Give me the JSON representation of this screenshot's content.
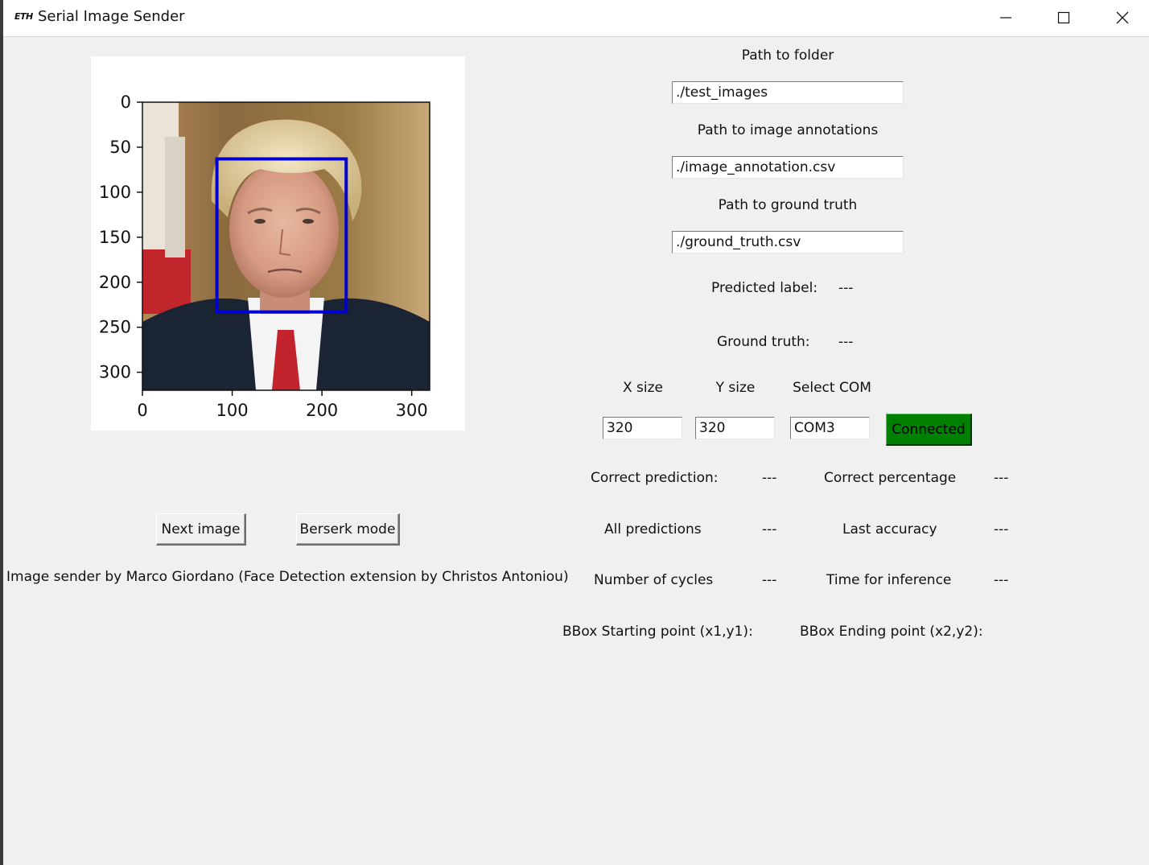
{
  "window": {
    "logo_text": "ETH",
    "title": "Serial Image Sender"
  },
  "plot": {
    "y_ticks": [
      "0",
      "50",
      "100",
      "150",
      "200",
      "250",
      "300"
    ],
    "x_ticks": [
      "0",
      "100",
      "200",
      "300"
    ],
    "image_size": [
      320,
      320
    ],
    "bbox": {
      "x1": 83,
      "y1": 63,
      "x2": 227,
      "y2": 233,
      "color": "#0000d0"
    }
  },
  "paths": {
    "folder_label": "Path to folder",
    "folder_value": "./test_images",
    "annotations_label": "Path to image annotations",
    "annotations_value": "./image_annotation.csv",
    "ground_truth_label": "Path to ground truth",
    "ground_truth_value": "./ground_truth.csv"
  },
  "results": {
    "predicted_label": "Predicted label:",
    "predicted_value": "---",
    "ground_truth_label": "Ground truth:",
    "ground_truth_value": "---"
  },
  "serial": {
    "x_size_label": "X size",
    "y_size_label": "Y size",
    "com_label": "Select COM",
    "x_size_value": "320",
    "y_size_value": "320",
    "com_value": "COM3",
    "connect_label": "Connected",
    "connect_color": "#008000"
  },
  "stats": {
    "correct_prediction_label": "Correct prediction:",
    "correct_prediction_value": "---",
    "correct_percentage_label": "Correct percentage",
    "correct_percentage_value": "---",
    "all_predictions_label": "All predictions",
    "all_predictions_value": "---",
    "last_accuracy_label": "Last accuracy",
    "last_accuracy_value": "---",
    "cycles_label": "Number of cycles",
    "cycles_value": "---",
    "inference_label": "Time for inference",
    "inference_value": "---",
    "bbox_start_label": "BBox Starting point (x1,y1):",
    "bbox_end_label": "BBox Ending point (x2,y2):"
  },
  "controls": {
    "next_image_label": "Next image",
    "berserk_label": "Berserk mode"
  },
  "footer": {
    "credits": "Image sender by Marco Giordano (Face Detection extension by Christos Antoniou)"
  }
}
